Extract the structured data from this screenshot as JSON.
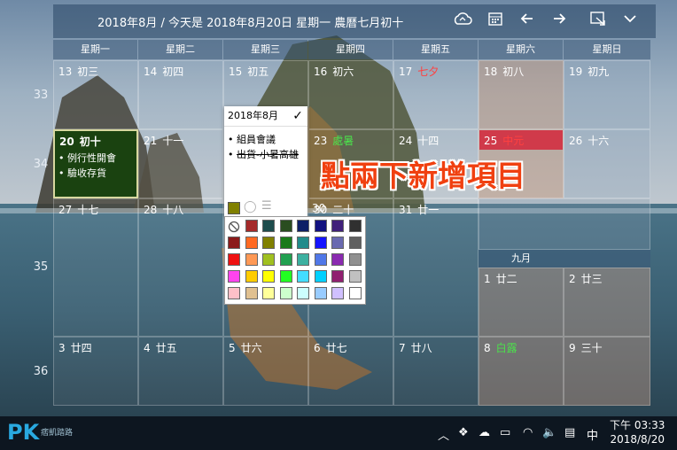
{
  "header": {
    "title": "2018年8月 / 今天是 2018年8月20日 星期一 農曆七月初十"
  },
  "toolbar_icons": [
    "cloud-sync-icon",
    "calendar-icon",
    "arrow-left-icon",
    "arrow-right-icon",
    "window-icon",
    "chevron-down-icon"
  ],
  "weekdays": [
    "星期一",
    "星期二",
    "星期三",
    "星期四",
    "星期五",
    "星期六",
    "星期日"
  ],
  "week_numbers": [
    "33",
    "34",
    "35",
    "36"
  ],
  "weeks": [
    [
      {
        "day": "13",
        "lunar": "初三"
      },
      {
        "day": "14",
        "lunar": "初四"
      },
      {
        "day": "15",
        "lunar": "初五"
      },
      {
        "day": "16",
        "lunar": "初六"
      },
      {
        "day": "17",
        "lunar": "七夕",
        "red": true
      },
      {
        "day": "18",
        "lunar": "初八"
      },
      {
        "day": "19",
        "lunar": "初九"
      }
    ],
    [
      {
        "day": "20",
        "lunar": "初十",
        "today": true,
        "events": [
          "例行性開會",
          "驗收存貨"
        ]
      },
      {
        "day": "21",
        "lunar": "十一"
      },
      {
        "day": "22",
        "lunar": ""
      },
      {
        "day": "23",
        "lunar": "處暑",
        "green": true
      },
      {
        "day": "24",
        "lunar": "十四"
      },
      {
        "day": "25",
        "lunar": "中元",
        "red": true,
        "highlight": true
      },
      {
        "day": "26",
        "lunar": "十六"
      }
    ],
    [
      {
        "day": "27",
        "lunar": "十七"
      },
      {
        "day": "28",
        "lunar": "十八"
      },
      {
        "day": "29",
        "lunar": ""
      },
      {
        "day": "30",
        "lunar": "二十"
      },
      {
        "day": "31",
        "lunar": "廿一"
      }
    ],
    [
      {
        "day": "3",
        "lunar": "廿四"
      },
      {
        "day": "4",
        "lunar": "廿五"
      },
      {
        "day": "5",
        "lunar": "廿六"
      },
      {
        "day": "6",
        "lunar": "廿七"
      },
      {
        "day": "7",
        "lunar": "廿八"
      },
      {
        "day": "8",
        "lunar": "白露",
        "green": true
      },
      {
        "day": "9",
        "lunar": "三十"
      }
    ]
  ],
  "sept_block": {
    "month_label": "九月",
    "days": [
      {
        "day": "1",
        "lunar": "廿二"
      },
      {
        "day": "2",
        "lunar": "廿三"
      }
    ]
  },
  "popup": {
    "title": "2018年8月",
    "items": [
      "組員會議",
      "出貨-小暑高雄"
    ]
  },
  "palette_colors": [
    [
      "none",
      "#a52a2a",
      "#1e4d4d",
      "#2a4d20",
      "#0e1f66",
      "#121280",
      "#40207a",
      "#303030"
    ],
    [
      "#8b1a1a",
      "#ff6a22",
      "#808000",
      "#1a7a1a",
      "#228b8b",
      "#1414ff",
      "#6a6ab0",
      "#606060"
    ],
    [
      "#ee1111",
      "#ff9955",
      "#a0c020",
      "#22a050",
      "#3cb0a0",
      "#5078e8",
      "#8a2ab0",
      "#909090"
    ],
    [
      "#ff44ee",
      "#ffcc00",
      "#ffff00",
      "#22ff22",
      "#44ddff",
      "#00d0ff",
      "#902070",
      "#c0c0c0"
    ],
    [
      "#ffc0c8",
      "#e0c090",
      "#ffff99",
      "#ccffcc",
      "#ccffff",
      "#99ccff",
      "#d0c0ff",
      "#ffffff"
    ]
  ],
  "banner": "點兩下新增項目",
  "taskbar": {
    "logo": "PK",
    "logo_sub": "痞凱踏路",
    "ime": "中",
    "time": "下午 03:33",
    "date": "2018/8/20"
  }
}
